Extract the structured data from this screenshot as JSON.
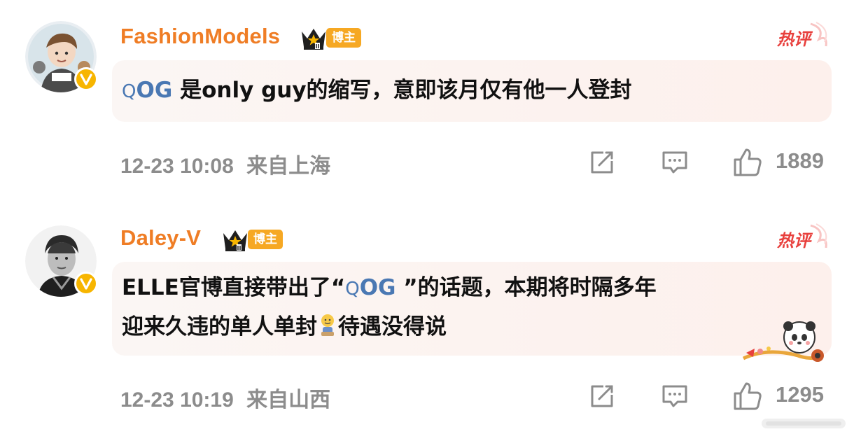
{
  "colors": {
    "username": "#ef7d25",
    "topic": "#4a78b3",
    "hot": "#e8403d",
    "meta": "#8c8c8c",
    "badge": "#f6a823"
  },
  "comments": [
    {
      "username": "FashionModels",
      "badge_label": "博主",
      "hot_label": "热评",
      "topic": "OG",
      "text": " 是only guy的缩写，意即该月仅有他一人登封",
      "timestamp": "12-23 10:08",
      "location": "来自上海",
      "likes": "1889"
    },
    {
      "username": "Daley-V",
      "badge_label": "博主",
      "hot_label": "热评",
      "text_pre": "ELLE官博直接带出了“",
      "topic": "OG",
      "text_post": " ”的话题，本期将时隔多年",
      "text_line2_a": "迎来久违的单人单封",
      "text_line2_b": "待遇没得说",
      "timestamp": "12-23 10:19",
      "location": "来自山西",
      "likes": "1295"
    }
  ],
  "icons": [
    "search-icon",
    "share-icon",
    "comment-icon",
    "like-icon",
    "crown-icon",
    "verified-v-icon"
  ]
}
